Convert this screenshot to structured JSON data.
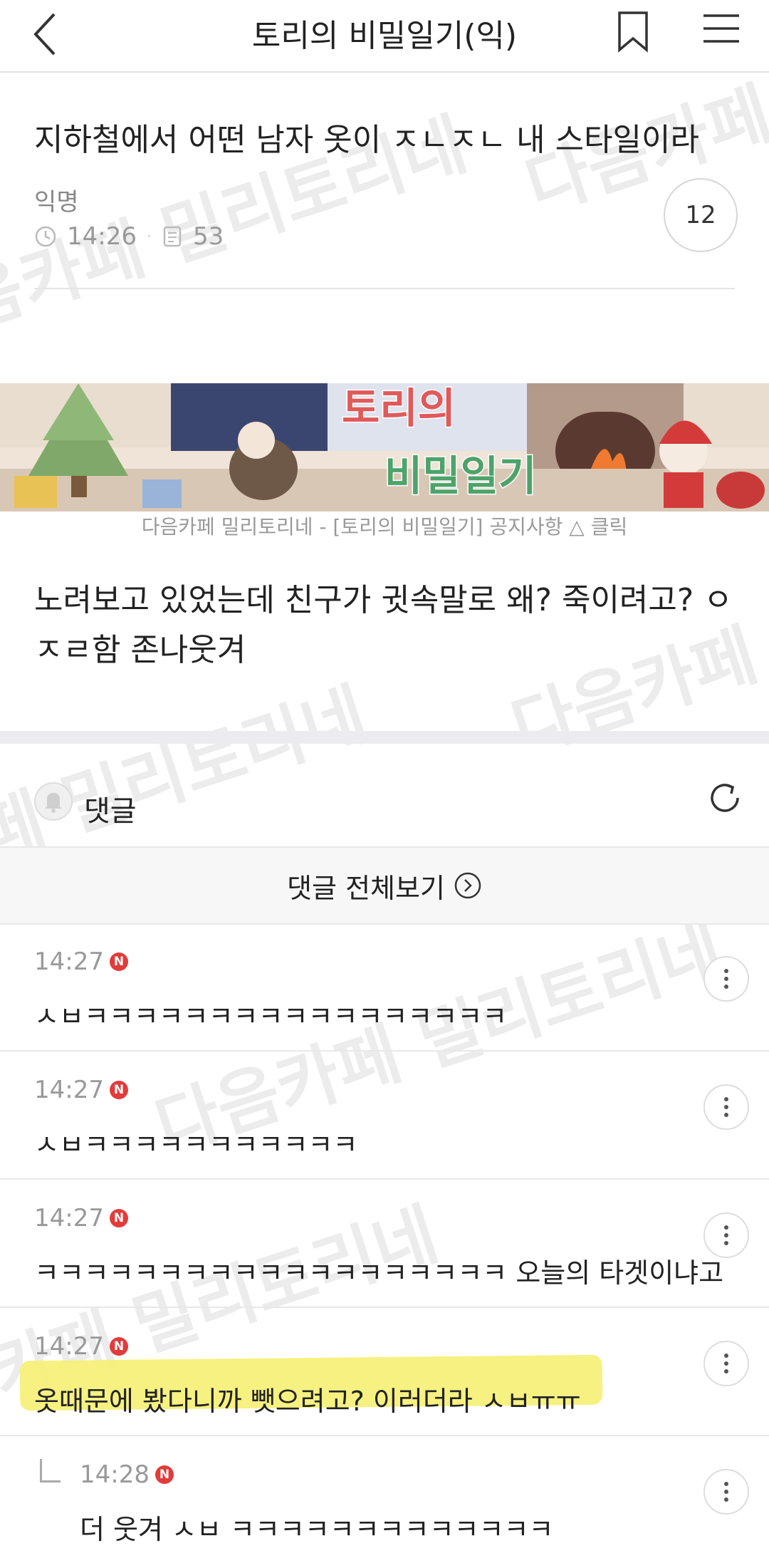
{
  "header": {
    "title": "토리의 비밀일기(익)"
  },
  "post": {
    "title": "지하철에서 어떤 남자 옷이 ㅈㄴㅈㄴ 내 스타일이라",
    "author": "익명",
    "time": "14:26",
    "views": "53",
    "comment_count": "12"
  },
  "banner": {
    "caption": "다음카페 밀리토리네 - [토리의 비밀일기] 공지사항 △ 클릭",
    "logo_line1": "토리의",
    "logo_line2": "비밀일기"
  },
  "body": {
    "line1": "노려보고 있었는데 친구가 귓속말로 왜? 죽이려고? ㅇ",
    "line2": "ㅈㄹ함 존나웃겨"
  },
  "comments_section": {
    "label": "댓글",
    "view_all": "댓글 전체보기"
  },
  "comments": [
    {
      "time": "14:27",
      "badge": "N",
      "text": "ㅅㅂㅋㅋㅋㅋㅋㅋㅋㅋㅋㅋㅋㅋㅋㅋㅋㅋㅋ"
    },
    {
      "time": "14:27",
      "badge": "N",
      "text": "ㅅㅂㅋㅋㅋㅋㅋㅋㅋㅋㅋㅋㅋ"
    },
    {
      "time": "14:27",
      "badge": "N",
      "text": "ㅋㅋㅋㅋㅋㅋㅋㅋㅋㅋㅋㅋㅋㅋㅋㅋㅋㅋㅋ 오늘의 타겟이냐고"
    },
    {
      "time": "14:27",
      "badge": "N",
      "text": "옷때문에 봤다니까 뺏으려고? 이러더라 ㅅㅂㅠㅠ"
    },
    {
      "time": "14:28",
      "badge": "N",
      "text": "더 웃겨 ㅅㅂ ㅋㅋㅋㅋㅋㅋㅋㅋㅋㅋㅋㅋㅋ"
    }
  ],
  "watermark": "다음카페 밀리토리네",
  "colors": {
    "new_badge": "#e23b3b",
    "highlight": "#f6f07a"
  }
}
